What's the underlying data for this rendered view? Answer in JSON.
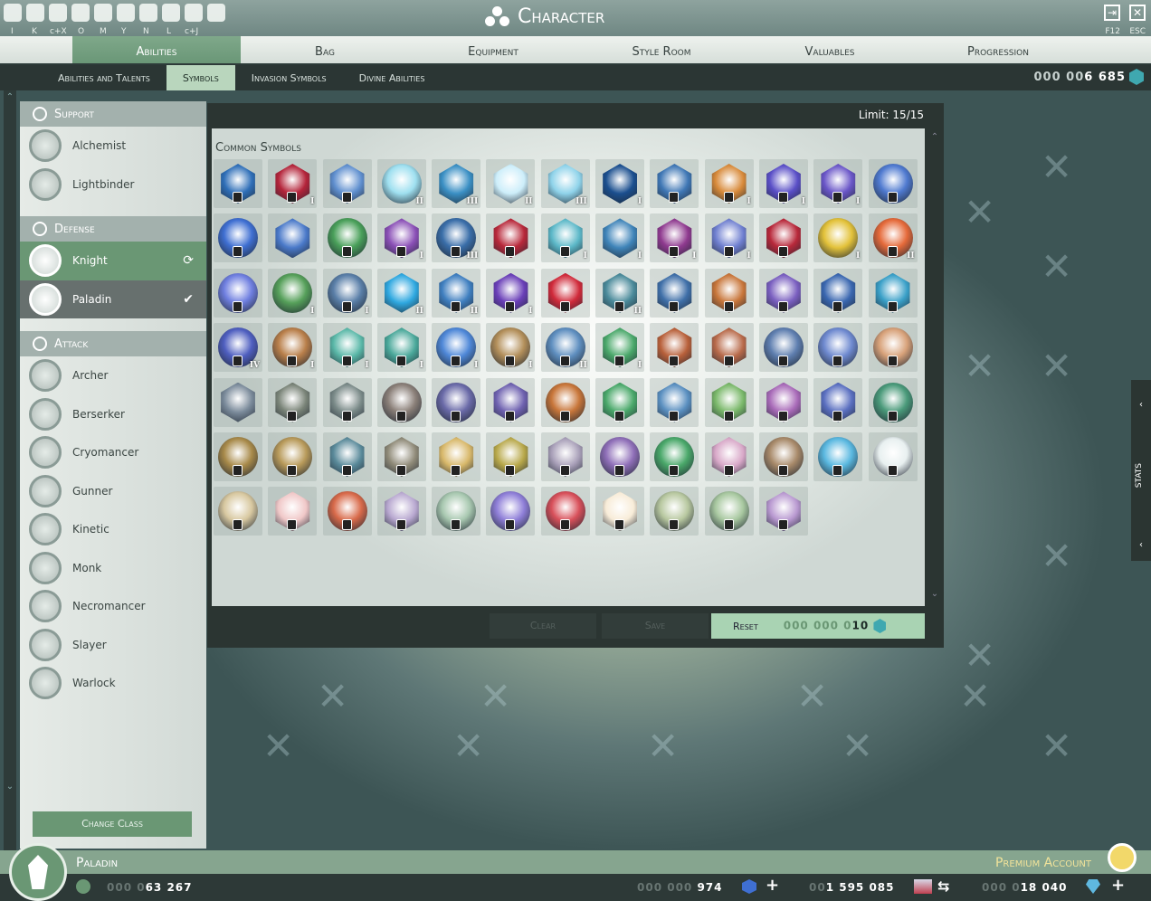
{
  "window": {
    "title": "Character"
  },
  "hotkeys": [
    "I",
    "K",
    "c+X",
    "O",
    "M",
    "Y",
    "N",
    "L",
    "c+J"
  ],
  "right_hotkeys": [
    "F12",
    "ESC"
  ],
  "main_tabs": [
    "Abilities",
    "Bag",
    "Equipment",
    "Style Room",
    "Valuables",
    "Progression"
  ],
  "main_active": 0,
  "sub_tabs": [
    "Abilities and Talents",
    "Symbols",
    "Invasion Symbols",
    "Divine Abilities"
  ],
  "sub_active": 1,
  "top_currency": {
    "dim": "000 00",
    "bright": "6 685"
  },
  "sidebar": {
    "categories": [
      {
        "name": "Support",
        "items": [
          "Alchemist",
          "Lightbinder"
        ]
      },
      {
        "name": "Defense",
        "items": [
          "Knight",
          "Paladin"
        ]
      },
      {
        "name": "Attack",
        "items": [
          "Archer",
          "Berserker",
          "Cryomancer",
          "Gunner",
          "Kinetic",
          "Monk",
          "Necromancer",
          "Slayer",
          "Warlock"
        ]
      }
    ],
    "change_class": "Change Class"
  },
  "symbols": {
    "limit": "Limit: 15/15",
    "group_title": "Common Symbols",
    "colors": [
      "#2f6fb8",
      "#b4243a",
      "#5f8fcf",
      "#9fe0f0",
      "#3a8fc4",
      "#cdeefa",
      "#8fd3ea",
      "#1b4f8f",
      "#3f77b5",
      "#d88a3a",
      "#5a4fc7",
      "#6a56c8",
      "#4f7ad0",
      "#3f6fd2",
      "#4a79c9",
      "#4aa05a",
      "#8a4fb6",
      "#3a6ea9",
      "#b8283a",
      "#5cb8c8",
      "#3f84b9",
      "#8f3a8f",
      "#6f7fd0",
      "#b8283a",
      "#e3c23a",
      "#e56a3a",
      "#6f7fe0",
      "#56a05a",
      "#5a7fa8",
      "#2fa8e0",
      "#3f7fc0",
      "#6a3fb8",
      "#d02a3a",
      "#4a8a9a",
      "#3f6fa8",
      "#c8763a",
      "#7a5fc0",
      "#3a67b0",
      "#3aa0c8",
      "#4f5fc0",
      "#b97f4a",
      "#5ab8a8",
      "#4aa89a",
      "#4f88d8",
      "#b38f5a",
      "#5f8fc0",
      "#4aa86a",
      "#b8603a",
      "#b86a4a",
      "#5f7fb0",
      "#6f8ad0",
      "#d8a27a",
      "#7a8a9a",
      "#7a8478",
      "#7a8a88",
      "#8a7f78",
      "#6a6aa8",
      "#6f62b0",
      "#c8763a",
      "#4aa86a",
      "#5a8fc0",
      "#7ab86a",
      "#a86ab8",
      "#5a6fc0",
      "#4a9a7a",
      "#a88a4a",
      "#b89a5a",
      "#5a8a9a",
      "#8f8a78",
      "#d8b86a",
      "#b8a84a",
      "#a89fb8",
      "#8f6fb8",
      "#4aa86a",
      "#d8a8c8",
      "#a88a6a",
      "#5ab8e0",
      "#e8f0f0",
      "#d8c8a0",
      "#f0c8c8",
      "#d86a4a",
      "#b8a8d0",
      "#a8c8b0",
      "#8f7fd8",
      "#d8505a",
      "#f8ecd8",
      "#b8c8a0",
      "#a8c8a0",
      "#b898d0"
    ],
    "round": [
      3,
      12,
      13,
      15,
      17,
      24,
      25,
      26,
      27,
      28,
      39,
      40,
      43,
      44,
      45,
      49,
      50,
      51,
      55,
      56,
      58,
      64,
      65,
      66,
      72,
      73,
      75,
      76,
      77,
      78,
      80,
      82,
      83,
      84,
      86,
      87
    ],
    "locked": [
      0,
      1,
      2,
      8,
      9,
      10,
      11,
      12,
      13,
      15,
      16,
      17,
      18,
      19,
      21,
      22,
      23,
      25,
      26,
      28,
      30,
      31,
      32,
      33,
      34,
      35,
      36,
      37,
      38,
      39,
      40,
      41,
      42,
      43,
      44,
      45,
      46,
      47,
      48,
      49,
      50,
      51,
      53,
      54,
      55,
      56,
      57,
      58,
      59,
      60,
      61,
      62,
      63,
      64,
      65,
      66,
      67,
      68,
      69,
      70,
      71,
      72,
      73,
      74,
      75,
      76,
      77,
      78,
      79,
      80,
      81,
      82,
      83,
      84,
      85,
      86,
      87,
      88
    ],
    "ranks": {
      "1": "I",
      "3": "II",
      "4": "III",
      "5": "II",
      "6": "III",
      "7": "I",
      "9": "I",
      "10": "I",
      "11": "I",
      "16": "I",
      "17": "III",
      "19": "I",
      "20": "I",
      "21": "I",
      "22": "I",
      "24": "I",
      "25": "II",
      "27": "I",
      "28": "I",
      "29": "II",
      "30": "II",
      "31": "I",
      "33": "II",
      "39": "IV",
      "40": "I",
      "41": "I",
      "42": "I",
      "43": "I",
      "44": "I",
      "45": "II",
      "46": "I"
    },
    "buttons": {
      "clear": "Clear",
      "save": "Save",
      "reset": "Reset"
    },
    "reset_cost": {
      "dim": "000 000 0",
      "bright": "10"
    }
  },
  "stats_tab": "STATS",
  "footer": {
    "class_name": "Paladin",
    "premium": "Premium Account",
    "level": {
      "dim": "000 0",
      "bright": "63 267"
    },
    "gems": {
      "dim": "000 000 ",
      "bright": "974"
    },
    "gold": {
      "dim": "00",
      "bright": "1 595 085"
    },
    "crystals": {
      "dim": "000 0",
      "bright": "18 040"
    }
  }
}
